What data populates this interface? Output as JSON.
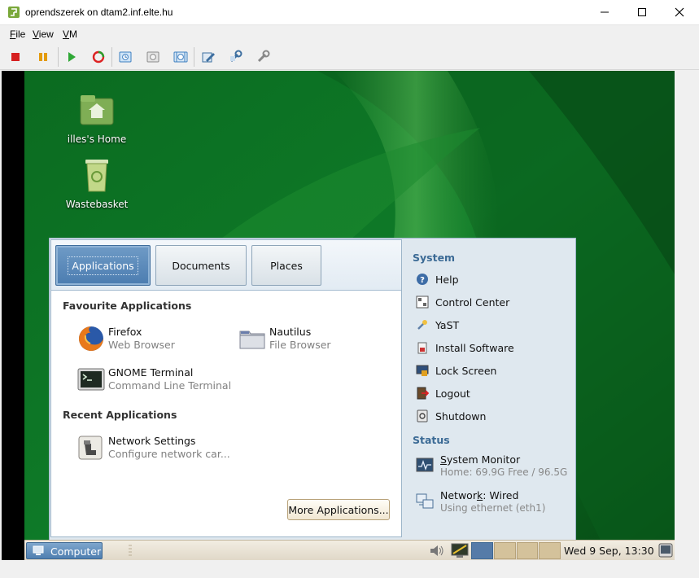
{
  "window": {
    "title": "oprendszerek on dtam2.inf.elte.hu"
  },
  "menubar": {
    "items": [
      {
        "label": "File",
        "accel": "F",
        "rest": "ile"
      },
      {
        "label": "View",
        "accel": "V",
        "rest": "iew"
      },
      {
        "label": "VM",
        "accel": "V",
        "rest": "M",
        "pre": ""
      }
    ]
  },
  "toolbar": {
    "buttons": [
      "stop",
      "pause",
      "start",
      "reset",
      "snapshot",
      "revert",
      "snapshot-manager",
      "settings",
      "install-tools",
      "preferences"
    ]
  },
  "desktop": {
    "icons": [
      {
        "label": "illes's Home"
      },
      {
        "label": "Wastebasket"
      }
    ]
  },
  "startmenu": {
    "tabs": [
      "Applications",
      "Documents",
      "Places"
    ],
    "favourites_title": "Favourite Applications",
    "favourites": [
      {
        "name": "Firefox",
        "desc": "Web Browser"
      },
      {
        "name": "Nautilus",
        "desc": "File Browser"
      },
      {
        "name": "GNOME Terminal",
        "desc": "Command Line Terminal"
      }
    ],
    "recent_title": "Recent Applications",
    "recent": [
      {
        "name": "Network Settings",
        "desc": "Configure network car..."
      }
    ],
    "more_label": "More Applications...",
    "system_title": "System",
    "system": [
      "Help",
      "Control Center",
      "YaST",
      "Install Software",
      "Lock Screen",
      "Logout",
      "Shutdown"
    ],
    "status_title": "Status",
    "status": [
      {
        "label_pre": "S",
        "label_rest": "ystem Monitor",
        "label": "System Monitor",
        "sub": "Home: 69.9G Free / 96.5G"
      },
      {
        "label_pre": "Networ",
        "label_u": "k",
        "label_rest": ":  Wired",
        "label": "Network:  Wired",
        "sub": "Using ethernet (eth1)"
      }
    ]
  },
  "panel": {
    "computer_label": "Computer",
    "clock": "Wed  9 Sep, 13:30",
    "workspaces": 4,
    "current_workspace": 1
  }
}
